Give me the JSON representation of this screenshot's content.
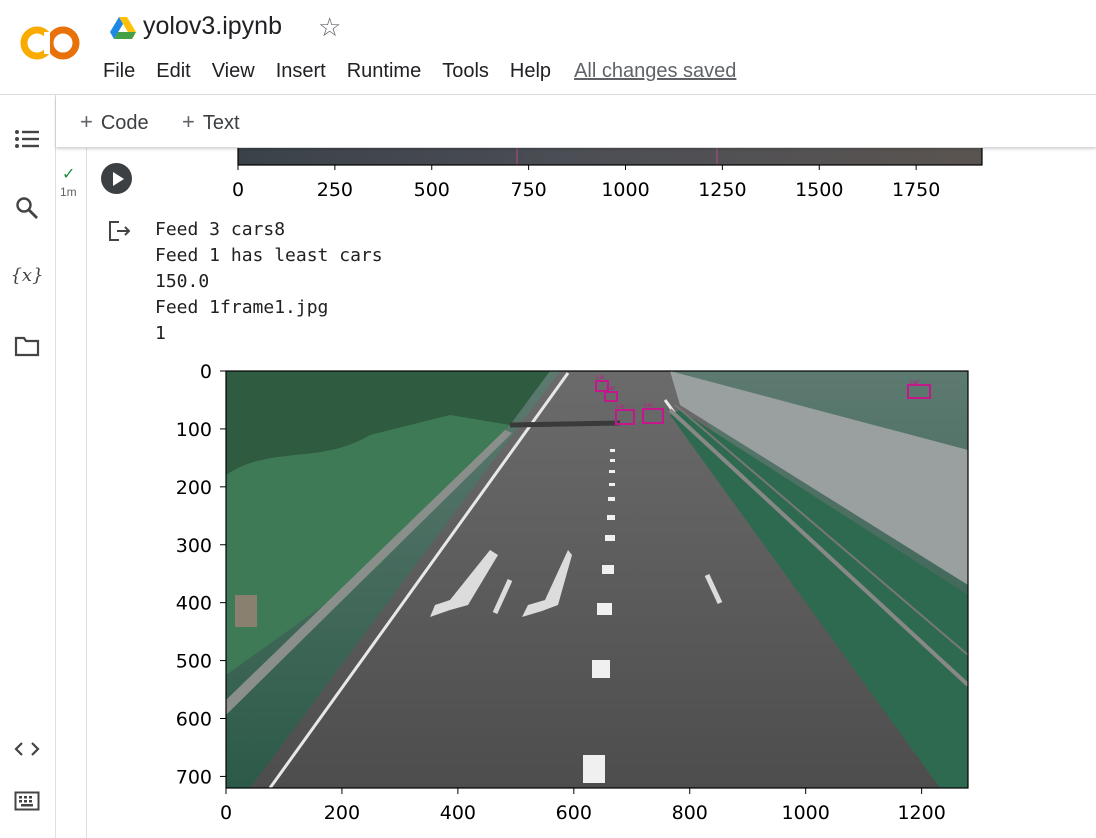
{
  "header": {
    "notebook_title": "yolov3.ipynb",
    "menu": [
      "File",
      "Edit",
      "View",
      "Insert",
      "Runtime",
      "Tools",
      "Help"
    ],
    "save_status": "All changes saved"
  },
  "toolbar": {
    "add_code": "Code",
    "add_text": "Text"
  },
  "sidebar": {
    "icons": [
      "table-of-contents-icon",
      "search-icon",
      "variables-icon",
      "files-icon",
      "code-snippets-icon",
      "command-palette-icon"
    ],
    "variables_glyph": "{x}"
  },
  "cell": {
    "elapsed": "1m",
    "status": "completed"
  },
  "output": {
    "lines": [
      "Feed 3 cars8",
      "Feed 1 has least cars",
      "150.0",
      "Feed 1frame1.jpg",
      "1"
    ]
  },
  "chart_data": [
    {
      "type": "image-plot",
      "x_ticks": [
        "0",
        "250",
        "500",
        "750",
        "1000",
        "1250",
        "1500",
        "1750"
      ],
      "y_ticks": []
    },
    {
      "type": "image-plot",
      "x_ticks": [
        "0",
        "200",
        "400",
        "600",
        "800",
        "1000",
        "1200"
      ],
      "y_ticks": [
        "0",
        "100",
        "200",
        "300",
        "400",
        "500",
        "600",
        "700"
      ],
      "detection_labels": [
        "car",
        "car",
        "car",
        "car",
        "car"
      ]
    }
  ]
}
